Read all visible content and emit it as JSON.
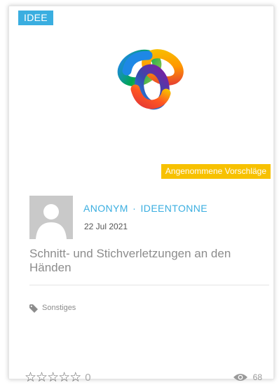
{
  "card": {
    "type_badge": "IDEE",
    "status_badge": "Angenommene Vorschläge",
    "author": "ANONYM",
    "separator": "·",
    "category": "IDEENTONNE",
    "date": "22 Jul 2021",
    "title": "Schnitt- und Stichverletzungen an den Händen",
    "tag": "Sonstiges",
    "rating": {
      "stars": 5,
      "filled": 0,
      "count": "0"
    },
    "views": "68"
  },
  "icons": {
    "logo": "rainbow-knot-logo",
    "avatar": "default-user-avatar",
    "tag": "tag-icon",
    "views": "eye-icon",
    "star": "star-outline-icon"
  },
  "colors": {
    "accent_blue": "#3aaee0",
    "status_yellow": "#f7c100",
    "avatar_gray": "#c9c9c9"
  }
}
